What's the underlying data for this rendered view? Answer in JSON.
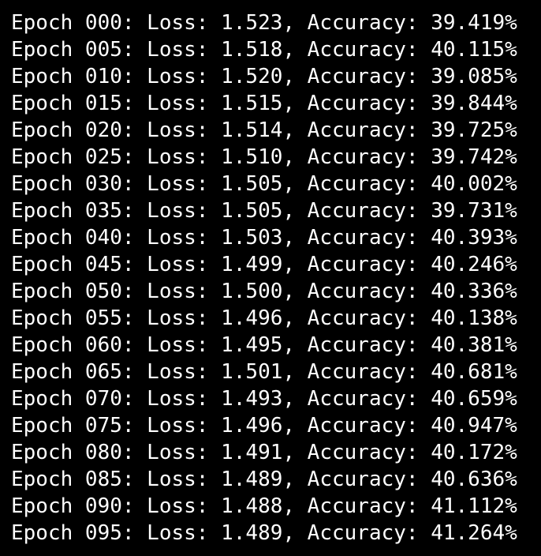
{
  "terminal": {
    "background_color": "#000000",
    "text_color": "#ffffff",
    "lines": [
      "Epoch 000: Loss: 1.523, Accuracy: 39.419%",
      "Epoch 005: Loss: 1.518, Accuracy: 40.115%",
      "Epoch 010: Loss: 1.520, Accuracy: 39.085%",
      "Epoch 015: Loss: 1.515, Accuracy: 39.844%",
      "Epoch 020: Loss: 1.514, Accuracy: 39.725%",
      "Epoch 025: Loss: 1.510, Accuracy: 39.742%",
      "Epoch 030: Loss: 1.505, Accuracy: 40.002%",
      "Epoch 035: Loss: 1.505, Accuracy: 39.731%",
      "Epoch 040: Loss: 1.503, Accuracy: 40.393%",
      "Epoch 045: Loss: 1.499, Accuracy: 40.246%",
      "Epoch 050: Loss: 1.500, Accuracy: 40.336%",
      "Epoch 055: Loss: 1.496, Accuracy: 40.138%",
      "Epoch 060: Loss: 1.495, Accuracy: 40.381%",
      "Epoch 065: Loss: 1.501, Accuracy: 40.681%",
      "Epoch 070: Loss: 1.493, Accuracy: 40.659%",
      "Epoch 075: Loss: 1.496, Accuracy: 40.947%",
      "Epoch 080: Loss: 1.491, Accuracy: 40.172%",
      "Epoch 085: Loss: 1.489, Accuracy: 40.636%",
      "Epoch 090: Loss: 1.488, Accuracy: 41.112%",
      "Epoch 095: Loss: 1.489, Accuracy: 41.264%"
    ]
  }
}
